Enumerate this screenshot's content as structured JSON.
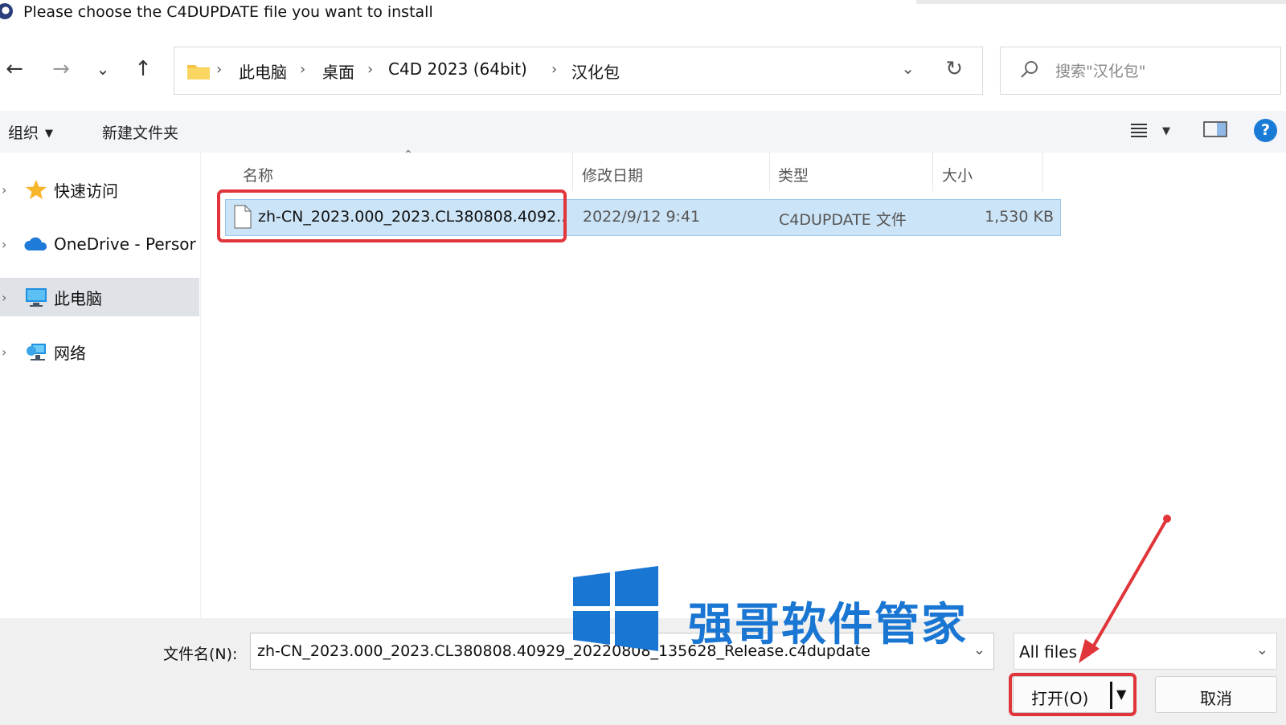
{
  "window": {
    "title": "Please choose the C4DUPDATE file you want to install"
  },
  "nav": {
    "back": "←",
    "forward": "→",
    "recent": "⌄",
    "up": "↑",
    "breadcrumbs": [
      "此电脑",
      "桌面",
      "C4D 2023 (64bit)",
      "汉化包"
    ],
    "breadcrumb_separator": "›",
    "refresh": "↻",
    "dropdown": "⌄"
  },
  "search": {
    "placeholder": "搜索\"汉化包\""
  },
  "commandbar": {
    "organize": "组织",
    "new_folder": "新建文件夹",
    "help": "?"
  },
  "sidebar": {
    "items": [
      {
        "label": "快速访问",
        "icon": "star-icon"
      },
      {
        "label": "OneDrive - Persor",
        "icon": "cloud-icon"
      },
      {
        "label": "此电脑",
        "icon": "computer-icon",
        "selected": true
      },
      {
        "label": "网络",
        "icon": "network-icon"
      }
    ]
  },
  "filelist": {
    "columns": {
      "name": "名称",
      "date": "修改日期",
      "type": "类型",
      "size": "大小"
    },
    "rows": [
      {
        "name": "zh-CN_2023.000_2023.CL380808.4092...",
        "date": "2022/9/12 9:41",
        "type": "C4DUPDATE 文件",
        "size": "1,530 KB",
        "selected": true
      }
    ]
  },
  "footer": {
    "filename_label": "文件名(N):",
    "filename_value": "zh-CN_2023.000_2023.CL380808.40929_20220808_135628_Release.c4dupdate",
    "filter_value": "All files",
    "open_label": "打开(O)",
    "cancel_label": "取消"
  },
  "watermark": {
    "text": "强哥软件管家"
  },
  "colors": {
    "accent": "#1a7bd6",
    "selection": "#cce4f7",
    "annotation": "#e0353a",
    "watermark": "#1976d2"
  }
}
